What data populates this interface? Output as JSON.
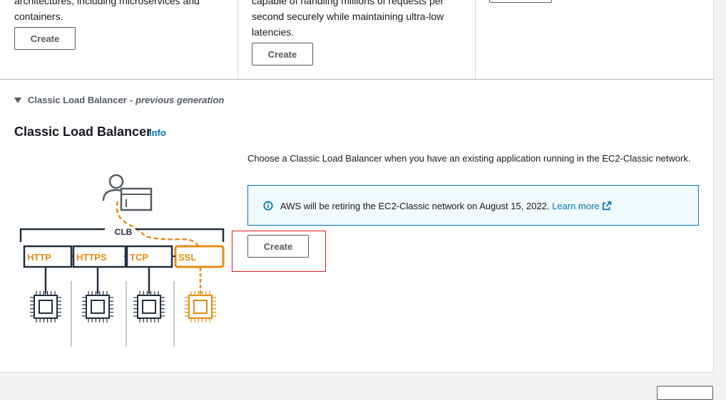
{
  "top_cards": {
    "card1": {
      "line1": "architectures, including microservices and",
      "line2": "containers.",
      "button": "Create"
    },
    "card2": {
      "line1": "capable of handling millions of requests per",
      "line2": "second securely while maintaining ultra-low",
      "line3": "latencies.",
      "button": "Create"
    }
  },
  "section": {
    "toggle_label": "Classic Load Balancer",
    "toggle_separator": "-",
    "toggle_suffix": "previous generation",
    "title": "Classic Load Balancer",
    "info_link": "Info",
    "description": "Choose a Classic Load Balancer when you have an existing application running in the EC2-Classic network.",
    "alert": {
      "message": "AWS will be retiring the EC2-Classic network on August 15, 2022.",
      "link": "Learn more"
    },
    "create_button": "Create"
  },
  "diagram": {
    "group_label": "CLB",
    "listeners": [
      "HTTP",
      "HTTPS",
      "TCP",
      "SSL"
    ],
    "highlight_listener": "SSL"
  },
  "colors": {
    "accent_orange": "#e88c10",
    "link_blue": "#0073bb",
    "highlight_red": "#e41b1b",
    "diagram_dark": "#232f3e"
  }
}
